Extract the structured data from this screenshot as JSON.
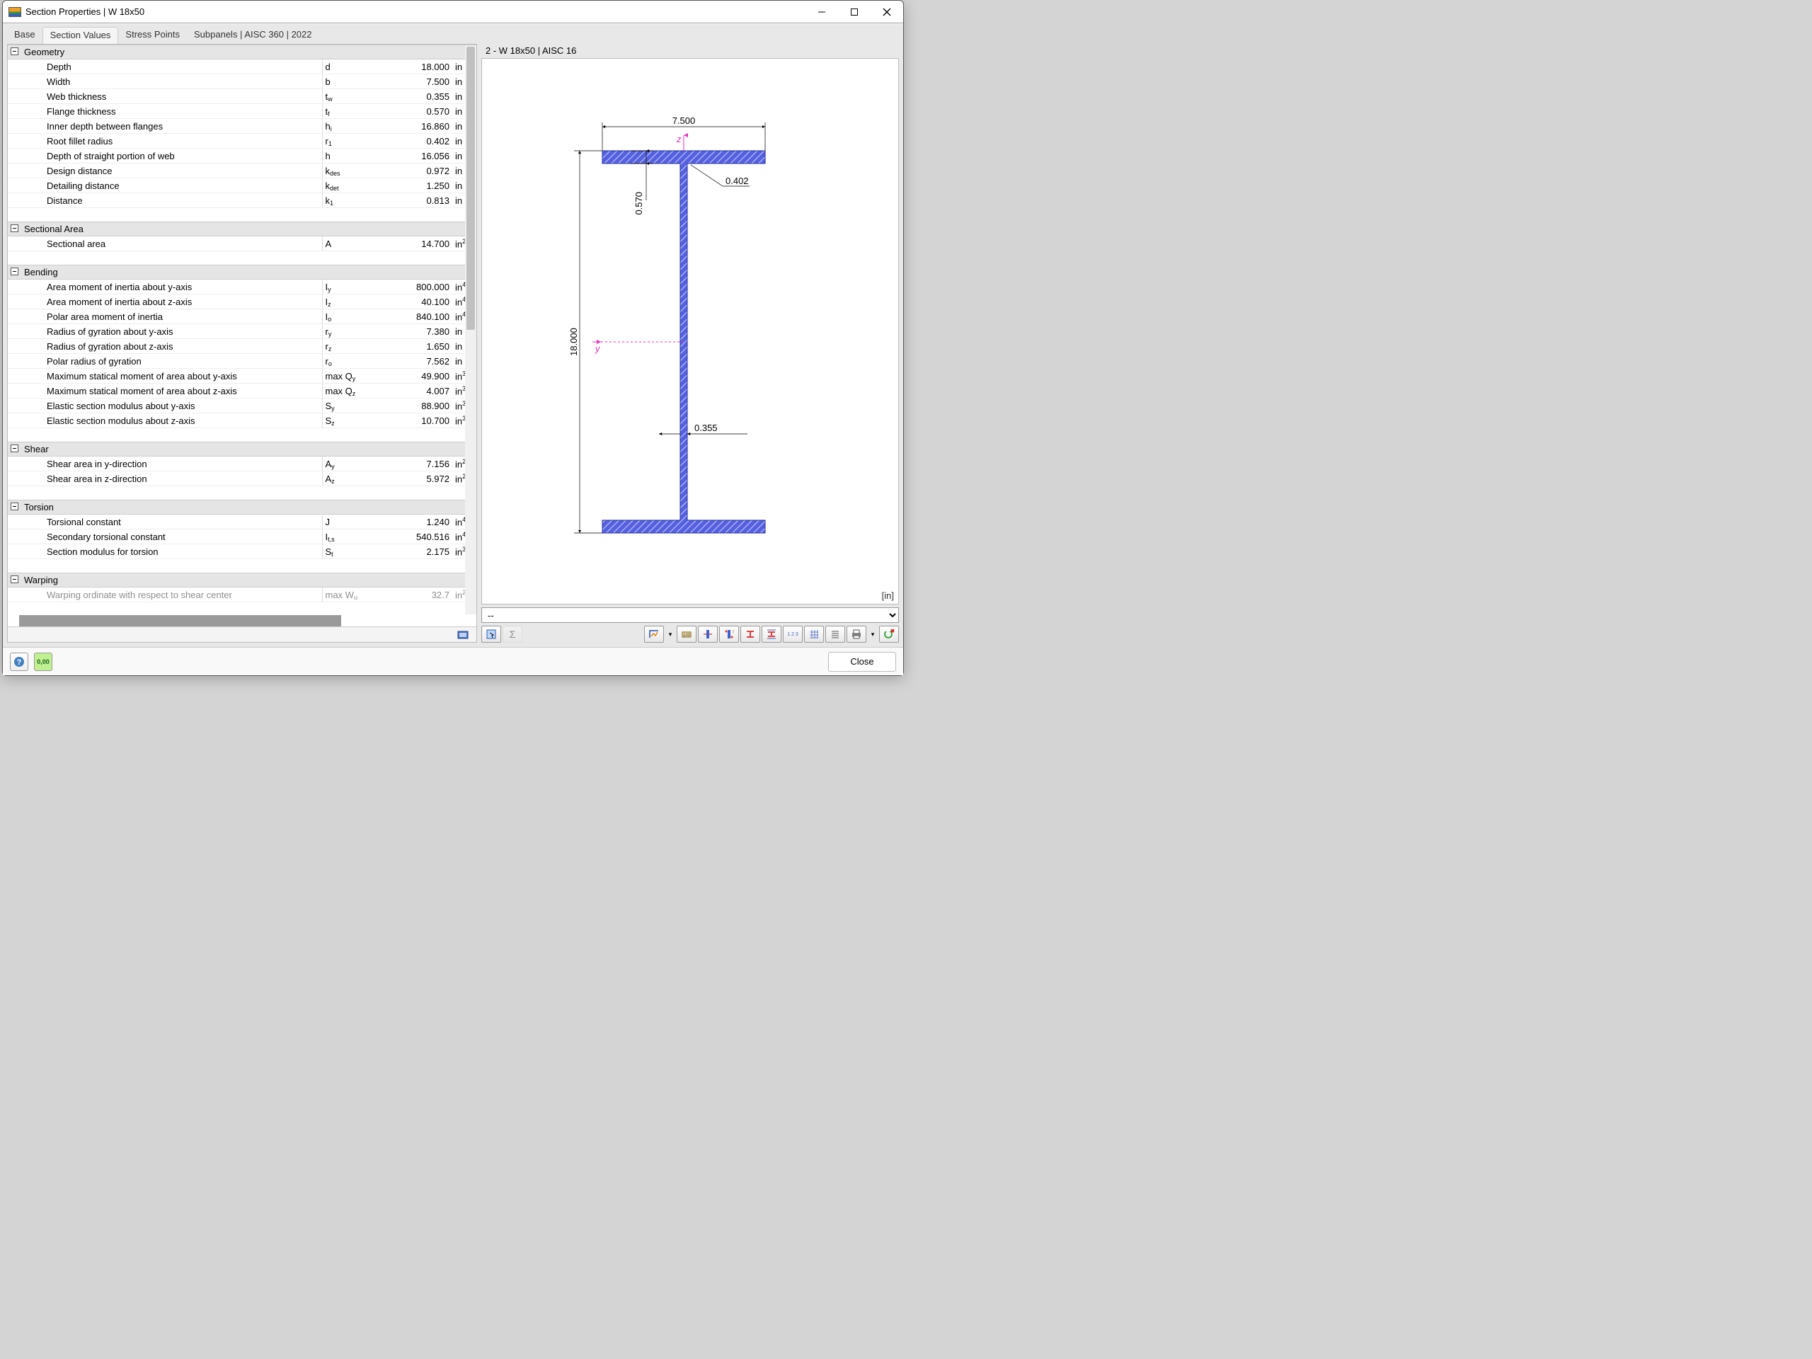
{
  "window": {
    "title": "Section Properties | W 18x50",
    "tabs": [
      "Base",
      "Section Values",
      "Stress Points",
      "Subpanels | AISC 360 | 2022"
    ],
    "active_tab": 1
  },
  "preview": {
    "title": "2 - W 18x50 | AISC 16",
    "unit_label": "[in]",
    "dropdown": "--"
  },
  "diagram": {
    "depth": "18.000",
    "width": "7.500",
    "flange_t": "0.570",
    "root_r": "0.402",
    "web_t": "0.355",
    "axis_y": "y",
    "axis_z": "z"
  },
  "footer": {
    "close": "Close"
  },
  "groups": [
    {
      "name": "Geometry",
      "rows": [
        {
          "desc": "Depth",
          "sym": "d",
          "val": "18.000",
          "unit": "in"
        },
        {
          "desc": "Width",
          "sym": "b",
          "val": "7.500",
          "unit": "in"
        },
        {
          "desc": "Web thickness",
          "sym": "t<sub>w</sub>",
          "val": "0.355",
          "unit": "in"
        },
        {
          "desc": "Flange thickness",
          "sym": "t<sub>f</sub>",
          "val": "0.570",
          "unit": "in"
        },
        {
          "desc": "Inner depth between flanges",
          "sym": "h<sub>i</sub>",
          "val": "16.860",
          "unit": "in"
        },
        {
          "desc": "Root fillet radius",
          "sym": "r<sub>1</sub>",
          "val": "0.402",
          "unit": "in"
        },
        {
          "desc": "Depth of straight portion of web",
          "sym": "h",
          "val": "16.056",
          "unit": "in"
        },
        {
          "desc": "Design distance",
          "sym": "k<sub>des</sub>",
          "val": "0.972",
          "unit": "in"
        },
        {
          "desc": "Detailing distance",
          "sym": "k<sub>det</sub>",
          "val": "1.250",
          "unit": "in"
        },
        {
          "desc": "Distance",
          "sym": "k<sub>1</sub>",
          "val": "0.813",
          "unit": "in"
        }
      ]
    },
    {
      "name": "Sectional Area",
      "rows": [
        {
          "desc": "Sectional area",
          "sym": "A",
          "val": "14.700",
          "unit": "in<sup>2</sup>"
        }
      ]
    },
    {
      "name": "Bending",
      "rows": [
        {
          "desc": "Area moment of inertia about y-axis",
          "sym": "I<sub>y</sub>",
          "val": "800.000",
          "unit": "in<sup>4</sup>"
        },
        {
          "desc": "Area moment of inertia about z-axis",
          "sym": "I<sub>z</sub>",
          "val": "40.100",
          "unit": "in<sup>4</sup>"
        },
        {
          "desc": "Polar area moment of inertia",
          "sym": "I<sub>o</sub>",
          "val": "840.100",
          "unit": "in<sup>4</sup>"
        },
        {
          "desc": "Radius of gyration about y-axis",
          "sym": "r<sub>y</sub>",
          "val": "7.380",
          "unit": "in"
        },
        {
          "desc": "Radius of gyration about z-axis",
          "sym": "r<sub>z</sub>",
          "val": "1.650",
          "unit": "in"
        },
        {
          "desc": "Polar radius of gyration",
          "sym": "r<sub>o</sub>",
          "val": "7.562",
          "unit": "in"
        },
        {
          "desc": "Maximum statical moment of area about y-axis",
          "sym": "max Q<sub>y</sub>",
          "val": "49.900",
          "unit": "in<sup>3</sup>"
        },
        {
          "desc": "Maximum statical moment of area about z-axis",
          "sym": "max Q<sub>z</sub>",
          "val": "4.007",
          "unit": "in<sup>3</sup>"
        },
        {
          "desc": "Elastic section modulus about y-axis",
          "sym": "S<sub>y</sub>",
          "val": "88.900",
          "unit": "in<sup>3</sup>"
        },
        {
          "desc": "Elastic section modulus about z-axis",
          "sym": "S<sub>z</sub>",
          "val": "10.700",
          "unit": "in<sup>3</sup>"
        }
      ]
    },
    {
      "name": "Shear",
      "rows": [
        {
          "desc": "Shear area in y-direction",
          "sym": "A<sub>y</sub>",
          "val": "7.156",
          "unit": "in<sup>2</sup>"
        },
        {
          "desc": "Shear area in z-direction",
          "sym": "A<sub>z</sub>",
          "val": "5.972",
          "unit": "in<sup>2</sup>"
        }
      ]
    },
    {
      "name": "Torsion",
      "rows": [
        {
          "desc": "Torsional constant",
          "sym": "J",
          "val": "1.240",
          "unit": "in<sup>4</sup>"
        },
        {
          "desc": "Secondary torsional constant",
          "sym": "I<sub>t,s</sub>",
          "val": "540.516",
          "unit": "in<sup>4</sup>"
        },
        {
          "desc": "Section modulus for torsion",
          "sym": "S<sub>t</sub>",
          "val": "2.175",
          "unit": "in<sup>3</sup>"
        }
      ]
    },
    {
      "name": "Warping",
      "rows": [
        {
          "desc": "Warping ordinate with respect to shear center",
          "sym": "max W<sub>u</sub>",
          "val": "32.7",
          "unit": "in<sup>2</sup>",
          "cut": true
        }
      ]
    }
  ]
}
